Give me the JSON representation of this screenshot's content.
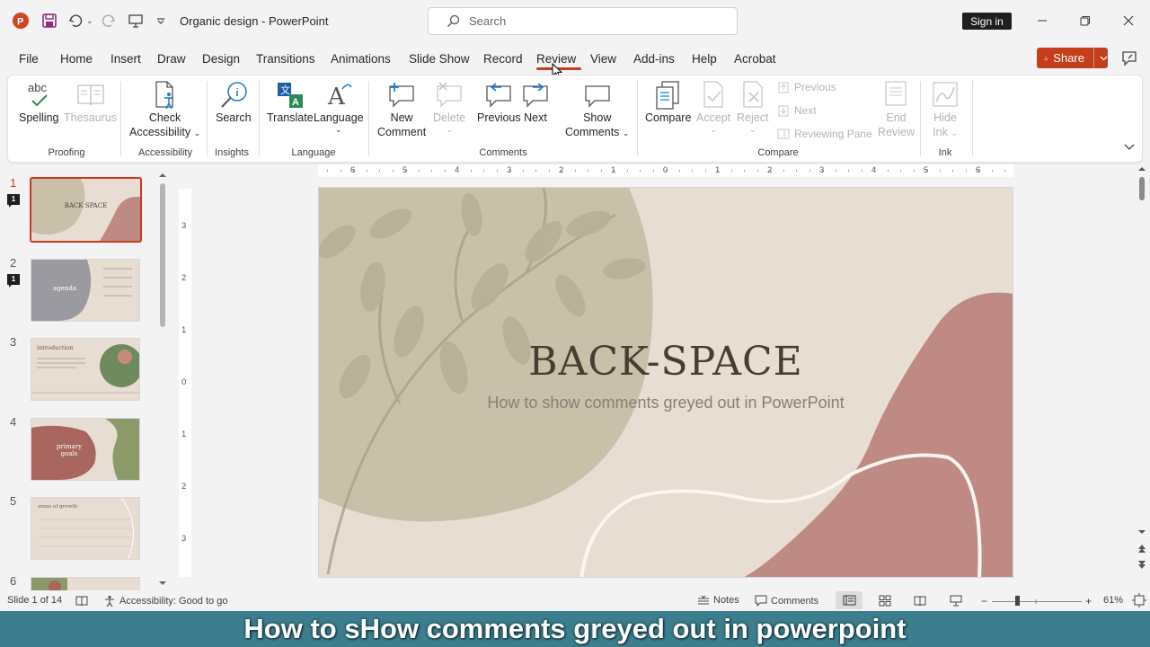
{
  "app": {
    "title": "Organic design  -  PowerPoint",
    "search_placeholder": "Search",
    "signin": "Sign in",
    "share": "Share"
  },
  "menu": {
    "tabs": [
      "File",
      "Home",
      "Insert",
      "Draw",
      "Design",
      "Transitions",
      "Animations",
      "Slide Show",
      "Record",
      "Review",
      "View",
      "Add-ins",
      "Help",
      "Acrobat"
    ],
    "active": "Review"
  },
  "ribbon": {
    "proofing": {
      "spelling": "Spelling",
      "thesaurus": "Thesaurus",
      "group": "Proofing"
    },
    "accessibility": {
      "check1": "Check",
      "check2": "Accessibility",
      "group": "Accessibility"
    },
    "insights": {
      "search": "Search",
      "group": "Insights"
    },
    "language": {
      "translate": "Translate",
      "language": "Language",
      "group": "Language"
    },
    "comments": {
      "new1": "New",
      "new2": "Comment",
      "delete": "Delete",
      "previous": "Previous",
      "next": "Next",
      "show1": "Show",
      "show2": "Comments",
      "group": "Comments"
    },
    "compare": {
      "compare": "Compare",
      "accept": "Accept",
      "reject": "Reject",
      "previous": "Previous",
      "next": "Next",
      "reviewing_pane": "Reviewing Pane",
      "end1": "End",
      "end2": "Review",
      "group": "Compare"
    },
    "ink": {
      "hide1": "Hide",
      "hide2": "Ink",
      "group": "Ink"
    }
  },
  "slides": [
    {
      "num": "1",
      "comments": "1",
      "label": "BACK SPACE"
    },
    {
      "num": "2",
      "comments": "1",
      "label": "agenda"
    },
    {
      "num": "3",
      "label": "introduction"
    },
    {
      "num": "4",
      "label": "primary goals"
    },
    {
      "num": "5",
      "label": "areas of growth"
    },
    {
      "num": "6"
    }
  ],
  "slide": {
    "title": "BACK-SPACE",
    "subtitle": "How to show comments greyed out in PowerPoint"
  },
  "ruler": {
    "h": [
      "6",
      "5",
      "4",
      "3",
      "2",
      "1",
      "0",
      "1",
      "2",
      "3",
      "4",
      "5",
      "6"
    ],
    "v": [
      "3",
      "2",
      "1",
      "0",
      "1",
      "2",
      "3"
    ]
  },
  "status": {
    "slide_of": "Slide 1 of 14",
    "accessibility": "Accessibility: Good to go",
    "notes": "Notes",
    "comments": "Comments",
    "zoom": "61%"
  },
  "caption": "How to sHow comments greyed out in powerpoint",
  "colors": {
    "accent": "#c43e1c",
    "slide_bg": "#e7ddd2",
    "sage": "#c8c0a8",
    "rose": "#bf8a83",
    "caption_bg": "#3c7e8d"
  }
}
